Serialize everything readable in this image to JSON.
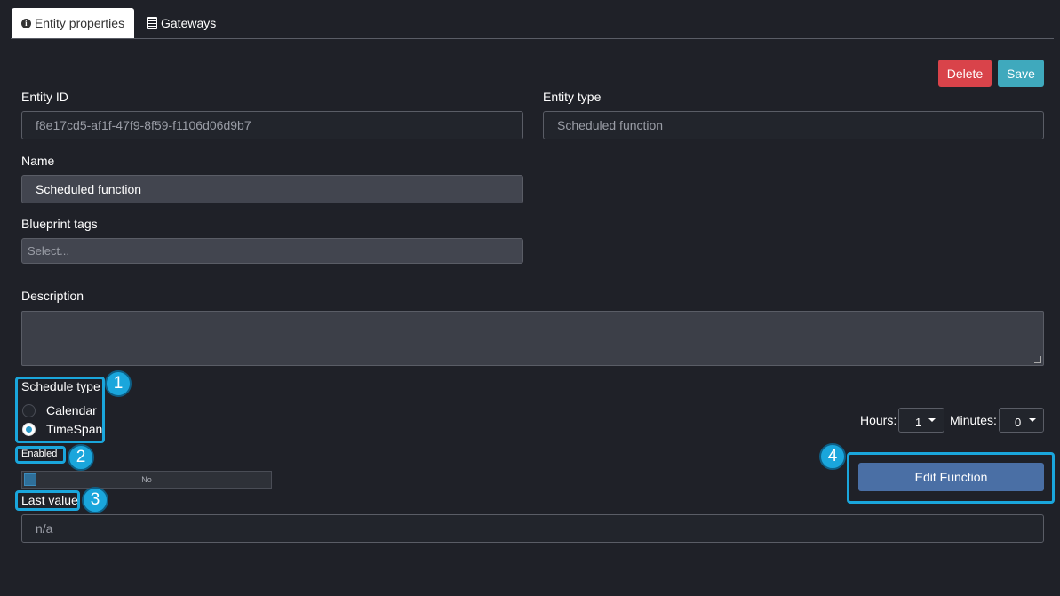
{
  "tabs": [
    {
      "label": "Entity properties",
      "icon": "info-circle-icon",
      "active": true
    },
    {
      "label": "Gateways",
      "icon": "gateway-icon",
      "active": false
    }
  ],
  "toolbar": {
    "delete_label": "Delete",
    "save_label": "Save"
  },
  "fields": {
    "entity_id": {
      "label": "Entity ID",
      "value": "f8e17cd5-af1f-47f9-8f59-f1106d06d9b7"
    },
    "entity_type": {
      "label": "Entity type",
      "value": "Scheduled function"
    },
    "name": {
      "label": "Name",
      "value": "Scheduled function"
    },
    "blueprint_tags": {
      "label": "Blueprint tags",
      "placeholder": "Select..."
    },
    "description": {
      "label": "Description",
      "value": ""
    },
    "last_value": {
      "label": "Last value",
      "value": "n/a"
    }
  },
  "schedule": {
    "label": "Schedule type",
    "options": [
      {
        "label": "Calendar",
        "selected": false
      },
      {
        "label": "TimeSpan",
        "selected": true
      }
    ],
    "hours_label": "Hours:",
    "hours_value": "1",
    "minutes_label": "Minutes:",
    "minutes_value": "0"
  },
  "enabled": {
    "label": "Enabled",
    "toggle_text": "No"
  },
  "edit_function_label": "Edit Function",
  "callouts": [
    "1",
    "2",
    "3",
    "4"
  ],
  "colors": {
    "background": "#1f2128",
    "delete": "#d9434a",
    "save": "#3fa9bd",
    "edit_function": "#4a6fa5",
    "highlight": "#1aa6dc"
  }
}
